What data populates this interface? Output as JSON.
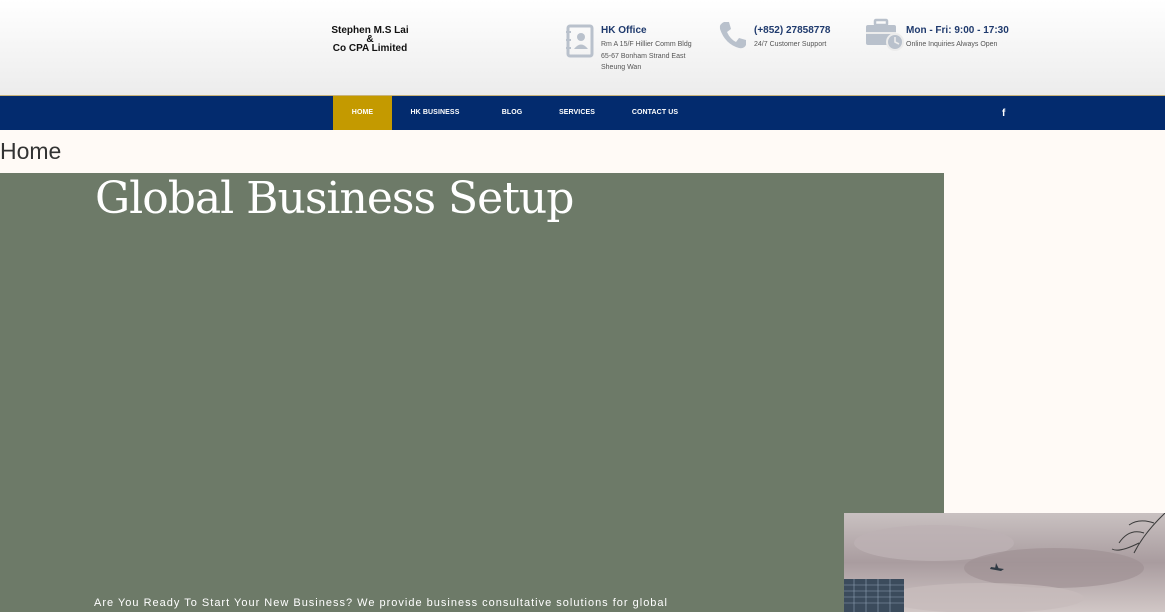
{
  "logo": {
    "line1": "Stephen M.S Lai",
    "line2": "&",
    "line3": "Co CPA Limited"
  },
  "header_info": {
    "office": {
      "icon": "address-book-icon",
      "title": "HK Office",
      "line1": "Rm A 15/F Hillier Comm Bldg",
      "line2": "65-67 Bonham Strand East",
      "line3": "Sheung Wan"
    },
    "phone": {
      "icon": "phone-icon",
      "title": "(+852) 27858778",
      "sub": "24/7 Customer Support"
    },
    "hours": {
      "icon": "briefcase-clock-icon",
      "title": "Mon - Fri: 9:00 - 17:30",
      "sub": "Online Inquiries Always Open"
    }
  },
  "nav": {
    "items": [
      {
        "label": "HOME",
        "active": true
      },
      {
        "label": "HK BUSINESS",
        "active": false
      },
      {
        "label": "BLOG",
        "active": false
      },
      {
        "label": "SERVICES",
        "active": false
      },
      {
        "label": "CONTACT US",
        "active": false
      }
    ],
    "social": "f"
  },
  "page_title": "Home",
  "hero": {
    "heading": "Global Business Setup",
    "text": "Are You Ready To Start Your New Business? We provide business consultative solutions for global"
  },
  "colors": {
    "nav_bg": "#032b6e",
    "nav_active": "#c49a00",
    "hero_bg": "#6d7a68",
    "page_bg": "#fffaf6",
    "info_title": "#1f3a6d"
  }
}
